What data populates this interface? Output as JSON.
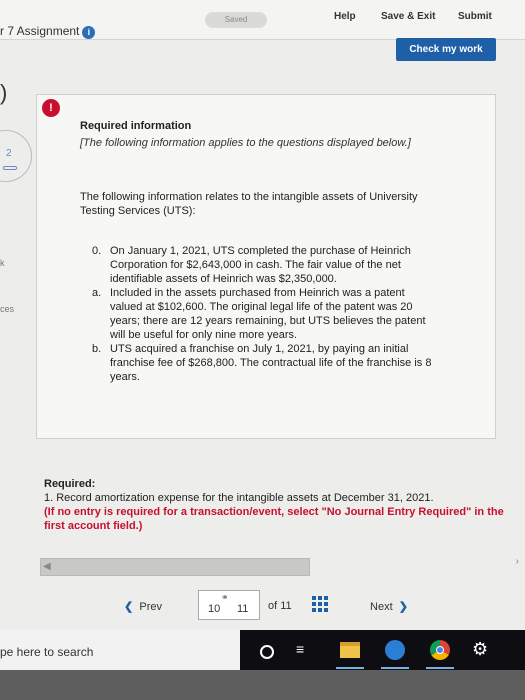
{
  "header": {
    "assignment_title": "r 7 Assignment",
    "saved_label": "Saved",
    "help_label": "Help",
    "save_exit_label": "Save & Exit",
    "submit_label": "Submit",
    "check_work_label": "Check my work"
  },
  "left_edge": {
    "paren": ")",
    "question_number": "2",
    "frag_k": "k",
    "frag_ces": "ces"
  },
  "info": {
    "heading": "Required information",
    "note": "[The following information applies to the questions displayed below.]",
    "intro": "The following information relates to the intangible assets of University Testing Services (UTS):",
    "items": [
      {
        "marker": "0.",
        "text": "On January 1, 2021, UTS completed the purchase of Heinrich Corporation for $2,643,000 in cash. The fair value of the net identifiable assets of Heinrich was $2,350,000."
      },
      {
        "marker": "a.",
        "text": "Included in the assets purchased from Heinrich was a patent valued at $102,600. The original legal life of the patent was 20 years; there are 12 years remaining, but UTS believes the patent will be useful for only nine more years."
      },
      {
        "marker": "b.",
        "text": "UTS acquired a franchise on July 1, 2021, by paying an initial franchise fee of $268,800. The contractual life of the franchise is 8 years."
      }
    ]
  },
  "required": {
    "label": "Required:",
    "task": "1. Record amortization expense for the intangible assets at December 31, 2021.",
    "instruction": "(If no entry is required for a transaction/event, select \"No Journal Entry Required\" in the first account field.)"
  },
  "pager": {
    "prev_label": "Prev",
    "current": "10",
    "next_page": "11",
    "of_label": "of 11",
    "next_label": "Next"
  },
  "taskbar": {
    "search_text": "pe here to search"
  }
}
